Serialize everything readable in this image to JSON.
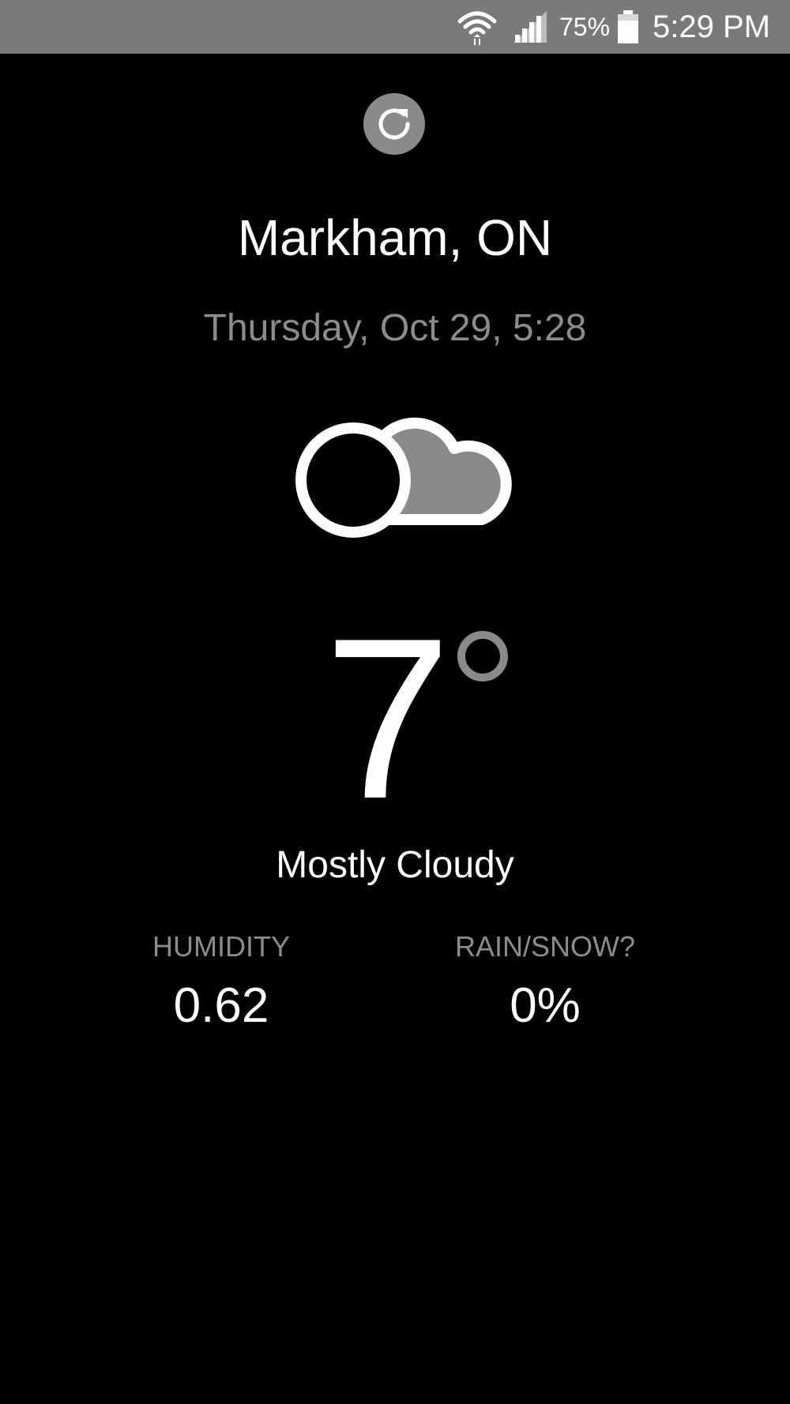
{
  "status_bar": {
    "wifi_icon": "wifi-icon",
    "signal_icon": "cell-signal-icon",
    "battery_percent": "75%",
    "battery_icon": "battery-icon",
    "battery_level": 0.75,
    "time": "5:29 PM"
  },
  "main": {
    "refresh_icon": "refresh-icon",
    "location": "Markham, ON",
    "datetime": "Thursday, Oct 29, 5:28",
    "weather_icon": "partly-cloudy-icon",
    "temperature": "7",
    "degree_icon": "degree-icon",
    "condition": "Mostly Cloudy"
  },
  "stats": {
    "humidity": {
      "label": "HUMIDITY",
      "value": "0.62"
    },
    "precipitation": {
      "label": "RAIN/SNOW?",
      "value": "0%"
    }
  },
  "colors": {
    "background": "#000000",
    "status_bar": "#7a7a7a",
    "primary_text": "#ffffff",
    "secondary_text": "#8c8c8c",
    "icon_gray": "#8a8a8a"
  }
}
